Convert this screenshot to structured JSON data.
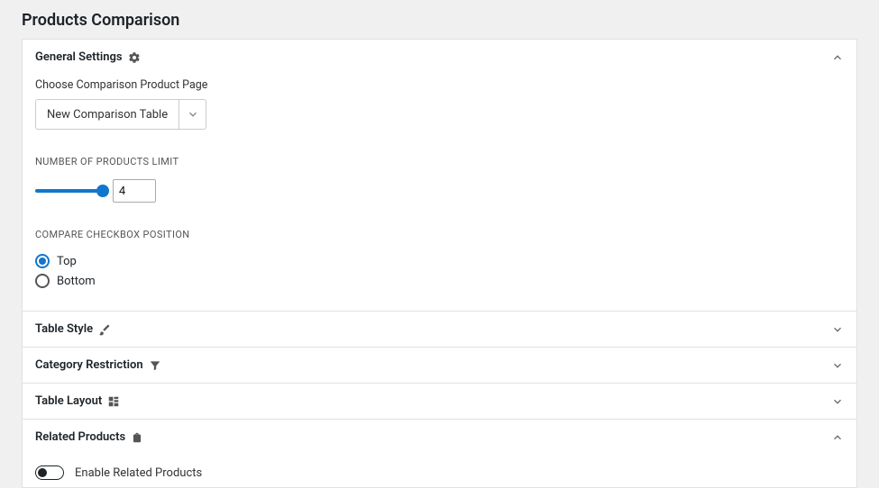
{
  "page_title": "Products Comparison",
  "sections": {
    "general": {
      "title": "General Settings",
      "choose_label": "Choose Comparison Product Page",
      "select_value": "New Comparison Table",
      "limit_label": "NUMBER OF PRODUCTS LIMIT",
      "limit_value": "4",
      "checkbox_pos_label": "COMPARE CHECKBOX POSITION",
      "radio_top": "Top",
      "radio_bottom": "Bottom"
    },
    "table_style": {
      "title": "Table Style"
    },
    "category_restriction": {
      "title": "Category Restriction"
    },
    "table_layout": {
      "title": "Table Layout"
    },
    "related": {
      "title": "Related Products",
      "enable_label": "Enable Related Products"
    }
  }
}
